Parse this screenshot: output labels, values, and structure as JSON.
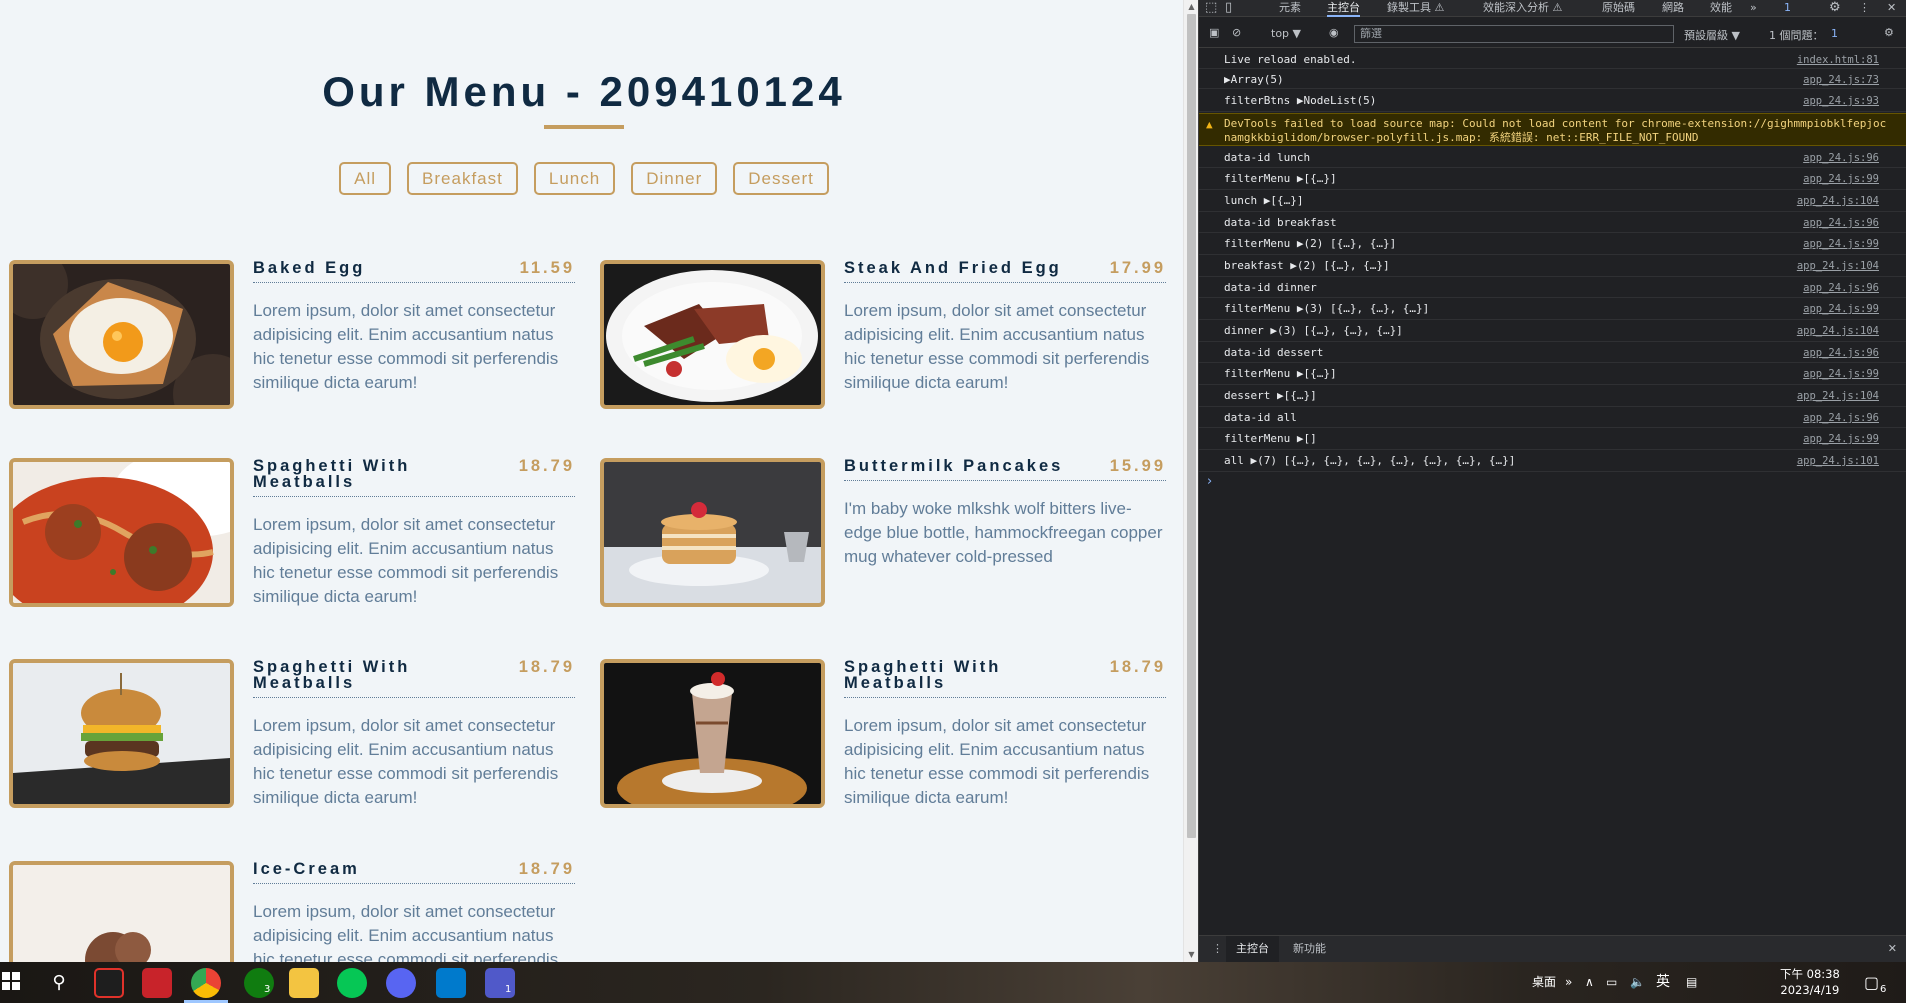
{
  "page": {
    "title": "Our Menu - 209410124",
    "filters": [
      "All",
      "Breakfast",
      "Lunch",
      "Dinner",
      "Dessert"
    ],
    "items": [
      {
        "name": "Baked Egg",
        "price": "11.59",
        "desc": "Lorem ipsum, dolor sit amet consectetur adipisicing elit. Enim accusantium natus hic tenetur esse commodi sit perferendis similique dicta earum!",
        "photo": "baked-egg-photo"
      },
      {
        "name": "Steak And Fried Egg",
        "price": "17.99",
        "desc": "Lorem ipsum, dolor sit amet consectetur adipisicing elit. Enim accusantium natus hic tenetur esse commodi sit perferendis similique dicta earum!",
        "photo": "steak-egg-photo"
      },
      {
        "name": "Spaghetti With Meatballs",
        "price": "18.79",
        "desc": "Lorem ipsum, dolor sit amet consectetur adipisicing elit. Enim accusantium natus hic tenetur esse commodi sit perferendis similique dicta earum!",
        "photo": "spaghetti-photo"
      },
      {
        "name": "Buttermilk Pancakes",
        "price": "15.99",
        "desc": "I'm baby woke mlkshk wolf bitters live-edge blue bottle, hammockfreegan copper mug whatever cold-pressed",
        "photo": "pancakes-photo"
      },
      {
        "name": "Spaghetti With Meatballs",
        "price": "18.79",
        "desc": "Lorem ipsum, dolor sit amet consectetur adipisicing elit. Enim accusantium natus hic tenetur esse commodi sit perferendis similique dicta earum!",
        "photo": "burger-photo"
      },
      {
        "name": "Spaghetti With Meatballs",
        "price": "18.79",
        "desc": "Lorem ipsum, dolor sit amet consectetur adipisicing elit. Enim accusantium natus hic tenetur esse commodi sit perferendis similique dicta earum!",
        "photo": "milkshake-photo"
      },
      {
        "name": "Ice-Cream",
        "price": "18.79",
        "desc": "Lorem ipsum, dolor sit amet consectetur adipisicing elit. Enim accusantium natus hic tenetur esse commodi sit perferendis similique dicta earum!",
        "photo": "ice-cream-photo"
      }
    ]
  },
  "devtools": {
    "tabs": [
      "元素",
      "主控台",
      "錄製工具 ⚠",
      "效能深入分析 ⚠",
      "原始碼",
      "網路",
      "效能"
    ],
    "active_tab": "主控台",
    "issue_badge": "1",
    "context": "top ▼",
    "filter_placeholder": "篩選",
    "levels": "預設層級 ▼",
    "issues": "1 個問題：",
    "issues_count": "1",
    "rows": [
      {
        "msg": "Live reload enabled.",
        "src": "index.html:81"
      },
      {
        "msg": "▶Array(5)",
        "src": "app_24.js:73"
      },
      {
        "msg": "filterBtns ▶NodeList(5)",
        "src": "app_24.js:93"
      },
      {
        "msg": "DevTools failed to load source map: Could not load content for chrome-extension://gighmmpiobklfepjoc",
        "msg2": "namgkkbiglidom/browser-polyfill.js.map: 系統錯誤: net::ERR_FILE_NOT_FOUND",
        "src": "",
        "warn": true
      },
      {
        "msg": "data-id lunch",
        "src": "app_24.js:96"
      },
      {
        "msg": "filterMenu ▶[{…}]",
        "src": "app_24.js:99"
      },
      {
        "msg": "lunch ▶[{…}]",
        "src": "app_24.js:104"
      },
      {
        "msg": "data-id breakfast",
        "src": "app_24.js:96"
      },
      {
        "msg": "filterMenu ▶(2) [{…}, {…}]",
        "src": "app_24.js:99"
      },
      {
        "msg": "breakfast ▶(2) [{…}, {…}]",
        "src": "app_24.js:104"
      },
      {
        "msg": "data-id dinner",
        "src": "app_24.js:96"
      },
      {
        "msg": "filterMenu ▶(3) [{…}, {…}, {…}]",
        "src": "app_24.js:99"
      },
      {
        "msg": "dinner ▶(3) [{…}, {…}, {…}]",
        "src": "app_24.js:104"
      },
      {
        "msg": "data-id dessert",
        "src": "app_24.js:96"
      },
      {
        "msg": "filterMenu ▶[{…}]",
        "src": "app_24.js:99"
      },
      {
        "msg": "dessert ▶[{…}]",
        "src": "app_24.js:104"
      },
      {
        "msg": "data-id all",
        "src": "app_24.js:96"
      },
      {
        "msg": "filterMenu ▶[]",
        "src": "app_24.js:99"
      },
      {
        "msg": "all ▶(7) [{…}, {…}, {…}, {…}, {…}, {…}, {…}]",
        "src": "app_24.js:101"
      }
    ],
    "prompt": "›",
    "drawer_tabs": [
      "主控台",
      "新功能"
    ]
  },
  "taskbar": {
    "desktop_label": "桌面",
    "ime": "英",
    "time": "下午 08:38",
    "date": "2023/4/19",
    "notif_count": "6",
    "xbox_badge": "3",
    "teams_badge": "1"
  },
  "colors": {
    "accent": "#c59d5f",
    "title": "#102a42",
    "text": "#617d98",
    "bg": "#f1f5f8"
  }
}
